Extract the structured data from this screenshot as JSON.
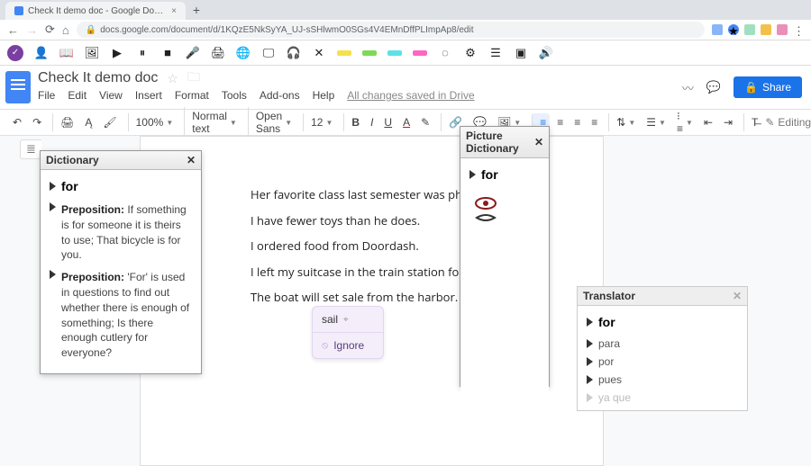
{
  "browser": {
    "tab_title": "Check It demo doc - Google Do…",
    "url": "docs.google.com/document/d/1KQzE5NkSyYA_UJ-sSHlwmO0SGs4V4EMnDffPLImpAp8/edit"
  },
  "doc": {
    "title": "Check It demo doc",
    "menus": [
      "File",
      "Edit",
      "View",
      "Insert",
      "Format",
      "Tools",
      "Add-ons",
      "Help"
    ],
    "saved": "All changes saved in Drive",
    "share": "Share",
    "zoom": "100%",
    "style": "Normal text",
    "font": "Open Sans",
    "size": "12",
    "editing": "Editing"
  },
  "content": {
    "l1": "Her favorite class last semester was physics.",
    "l2": "I have fewer toys than he does.",
    "l3": "I ordered food from Doordash.",
    "l4": "I left my suitcase in the train station for five hour",
    "l5a": "The boat will set ",
    "l5err": "sale",
    "l5b": " from the harbor."
  },
  "suggest": {
    "word": "sail",
    "ignore": "Ignore"
  },
  "dict": {
    "title": "Dictionary",
    "word": "for",
    "defs": [
      {
        "pos": "Preposition:",
        "text": "If something is for someone it is theirs to use; That bicycle is for you."
      },
      {
        "pos": "Preposition:",
        "text": "'For' is used in questions to find out whether there is enough of something; Is there enough cutlery for everyone?"
      }
    ]
  },
  "picdict": {
    "title": "Picture Dictionary",
    "word": "for"
  },
  "trans": {
    "title": "Translator",
    "word": "for",
    "items": [
      "para",
      "por",
      "pues",
      "ya que"
    ]
  }
}
